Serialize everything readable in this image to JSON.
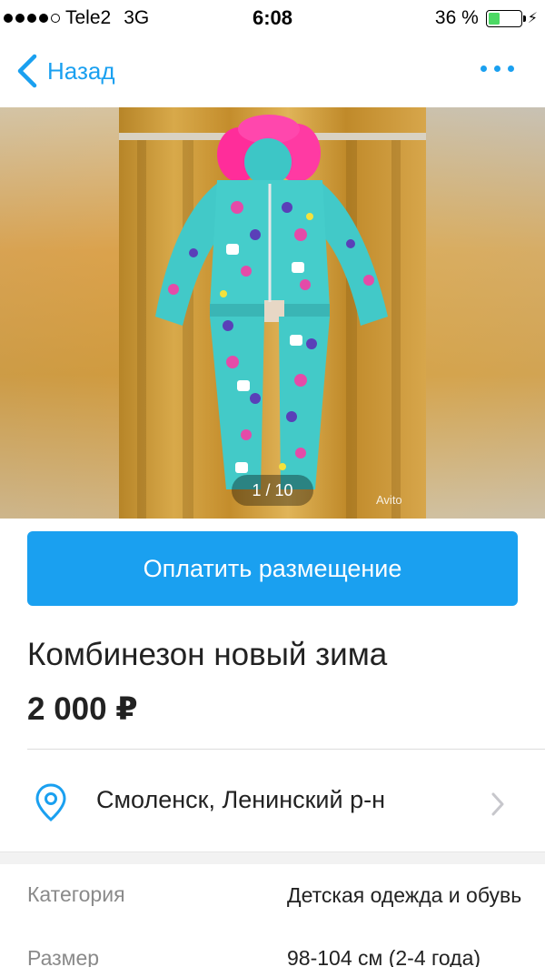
{
  "status_bar": {
    "carrier": "Tele2",
    "network": "3G",
    "time": "6:08",
    "battery_text": "36 %",
    "battery_level": 0.36
  },
  "nav": {
    "back_label": "Назад"
  },
  "gallery": {
    "page_indicator": "1 / 10",
    "watermark": "Avito"
  },
  "pay_button": {
    "label": "Оплатить размещение"
  },
  "listing": {
    "title": "Комбинезон новый зима",
    "price": "2 000 ₽",
    "location": "Смоленск, Ленинский р-н"
  },
  "params": [
    {
      "label": "Категория",
      "value": "Детская одежда и обувь"
    },
    {
      "label": "Размер",
      "value": "98-104 см (2-4 года)"
    }
  ],
  "colors": {
    "accent": "#1aa0f0",
    "battery_green": "#4cd964"
  }
}
